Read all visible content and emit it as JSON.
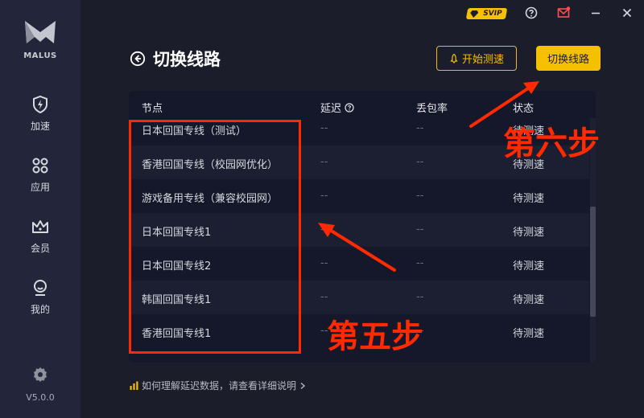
{
  "app": {
    "logo_text": "MALUS",
    "version": "V5.0.0",
    "svip_label": "SVIP"
  },
  "sidebar": {
    "items": [
      {
        "label": "加速",
        "icon": "lightning-shield-icon"
      },
      {
        "label": "应用",
        "icon": "apps-grid-icon"
      },
      {
        "label": "会员",
        "icon": "crown-icon"
      },
      {
        "label": "我的",
        "icon": "user-icon"
      }
    ]
  },
  "header": {
    "title": "切换线路",
    "test_button": "开始测速",
    "switch_button": "切换线路"
  },
  "table": {
    "columns": [
      "节点",
      "延迟",
      "丢包率",
      "状态"
    ],
    "rows": [
      {
        "node": "日本回国专线（测试）",
        "latency": "--",
        "loss": "--",
        "status": "待测速"
      },
      {
        "node": "香港回国专线（校园网优化）",
        "latency": "--",
        "loss": "--",
        "status": "待测速"
      },
      {
        "node": "游戏备用专线（兼容校园网）",
        "latency": "--",
        "loss": "--",
        "status": "待测速"
      },
      {
        "node": "日本回国专线1",
        "latency": "--",
        "loss": "--",
        "status": "待测速"
      },
      {
        "node": "日本回国专线2",
        "latency": "--",
        "loss": "--",
        "status": "待测速"
      },
      {
        "node": "韩国回国专线1",
        "latency": "--",
        "loss": "--",
        "status": "待测速"
      },
      {
        "node": "香港回国专线1",
        "latency": "--",
        "loss": "--",
        "status": "待测速"
      }
    ]
  },
  "footer": {
    "help_text": "如何理解延迟数据，请查看详细说明"
  },
  "annotations": {
    "step5": "第五步",
    "step6": "第六步",
    "color": "#ff2a00"
  },
  "colors": {
    "accent": "#f5c000",
    "background": "#1b1d2a",
    "sidebar": "#23253a",
    "table": "#15172a"
  }
}
